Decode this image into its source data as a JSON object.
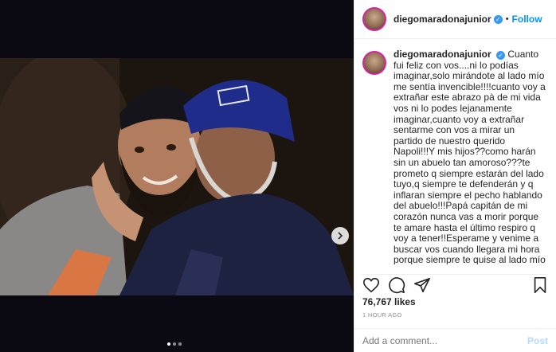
{
  "post": {
    "username": "diegomaradonajunior",
    "follow_label": "Follow",
    "separator": "•",
    "caption": "Cuanto fui feliz con vos....ni lo podías imaginar,solo mirándote al lado mío me sentía invencible!!!!cuanto voy a extrañar este abrazo pà de mi vida vos ni lo podes lejanamente imaginar,cuanto voy a extrañar sentarme con vos a mirar un partido de nuestro querido Napoli!!!Y mis hijos??como harán sin un abuelo tan amoroso???te prometo q siempre estarán del lado tuyo,q siempre te defenderán y q inflaran siempre el pecho hablando del abuelo!!!Papá capitán de mi corazón nunca vas a morir porque te amare hasta el último respiro q voy a tener!!Esperame y venime a buscar vos cuando llegara mi hora porque siempre te quise al lado mío porque",
    "likes": "76,767 likes",
    "time": "1 HOUR AGO",
    "comment_placeholder": "Add a comment...",
    "post_label": "Post"
  },
  "carousel": {
    "total_slides": 3,
    "current_slide": 1
  },
  "icons": {
    "verified": "verified-badge-icon",
    "like": "heart-icon",
    "comment": "comment-icon",
    "share": "share-icon",
    "save": "bookmark-icon",
    "next": "chevron-right-icon"
  },
  "colors": {
    "accent": "#0095f6",
    "verified": "#3897f0",
    "muted": "#8e8e8e"
  }
}
